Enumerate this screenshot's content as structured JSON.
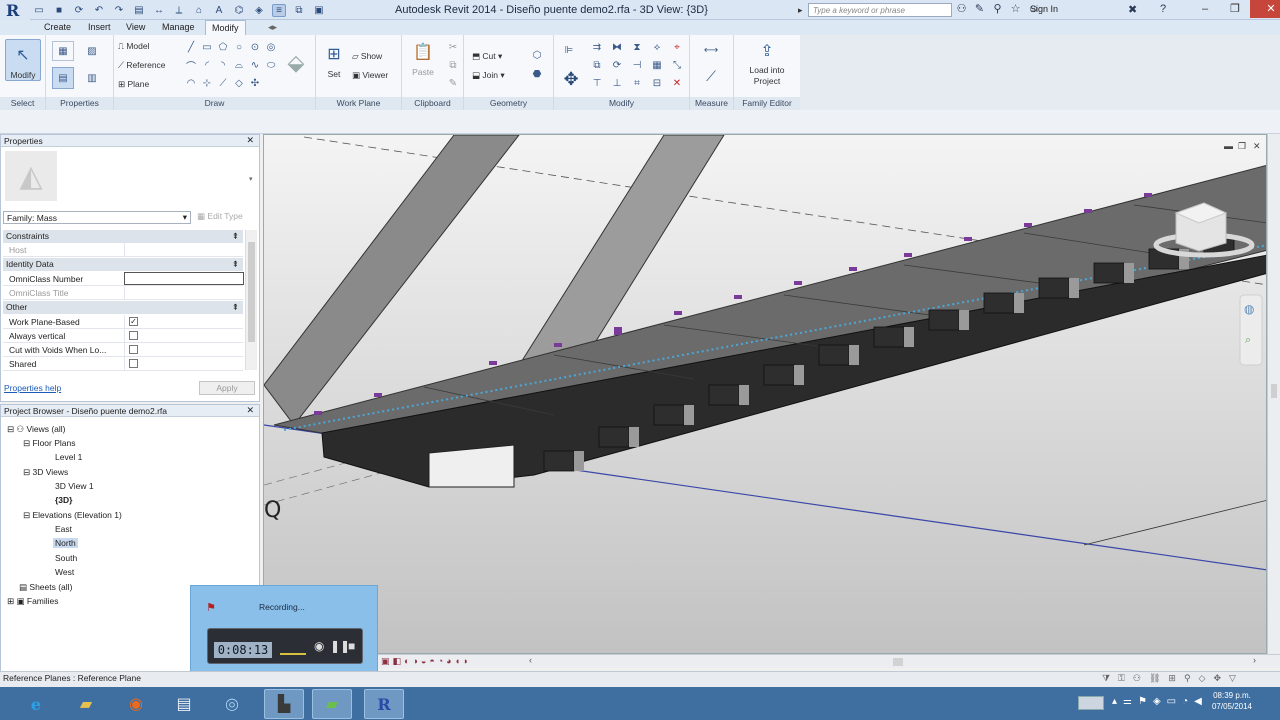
{
  "window": {
    "title": "Autodesk Revit 2014  -  Diseño puente demo2.rfa - 3D View: {3D}",
    "search_placeholder": "Type a keyword or phrase",
    "signin": "Sign In"
  },
  "tabs": [
    "Create",
    "Insert",
    "View",
    "Manage",
    "Modify"
  ],
  "active_tab": "Modify",
  "ribbon": {
    "select": {
      "modify_label": "Modify",
      "panel_label": "Select"
    },
    "properties": {
      "panel_label": "Properties"
    },
    "draw": {
      "model": "Model",
      "reference": "Reference",
      "plane": "Plane",
      "panel_label": "Draw"
    },
    "work_plane": {
      "set": "Set",
      "show": "Show",
      "viewer": "Viewer",
      "panel_label": "Work Plane"
    },
    "clipboard": {
      "paste": "Paste",
      "panel_label": "Clipboard"
    },
    "geometry": {
      "cut": "Cut",
      "join": "Join",
      "panel_label": "Geometry"
    },
    "modify": {
      "panel_label": "Modify"
    },
    "measure": {
      "panel_label": "Measure"
    },
    "family_editor": {
      "load": "Load into Project",
      "panel_label": "Family Editor"
    }
  },
  "properties": {
    "header": "Properties",
    "family_selector": "Family: Mass",
    "edit_type": "Edit Type",
    "sections": {
      "constraints": "Constraints",
      "identity": "Identity Data",
      "other": "Other"
    },
    "rows": {
      "host": "Host",
      "omniclass_number": "OmniClass Number",
      "omniclass_title": "OmniClass Title",
      "work_plane_based": "Work Plane-Based",
      "always_vertical": "Always vertical",
      "cut_with_voids": "Cut with Voids When Lo...",
      "shared": "Shared"
    },
    "help_link": "Properties help",
    "apply": "Apply"
  },
  "browser": {
    "header": "Project Browser - Diseño puente demo2.rfa",
    "items": {
      "views_all": "Views (all)",
      "floor_plans": "Floor Plans",
      "level1": "Level 1",
      "views3d": "3D Views",
      "view3d_1": "3D View 1",
      "view3d_default": "{3D}",
      "elevations": "Elevations (Elevation 1)",
      "east": "East",
      "north": "North",
      "south": "South",
      "west": "West",
      "sheets": "Sheets (all)",
      "families": "Families"
    }
  },
  "recording": {
    "status": "Recording...",
    "time": "0:08:13"
  },
  "status_bar": "Reference Planes : Reference Plane",
  "clock": {
    "time": "08:39 p.m.",
    "date": "07/05/2014"
  }
}
